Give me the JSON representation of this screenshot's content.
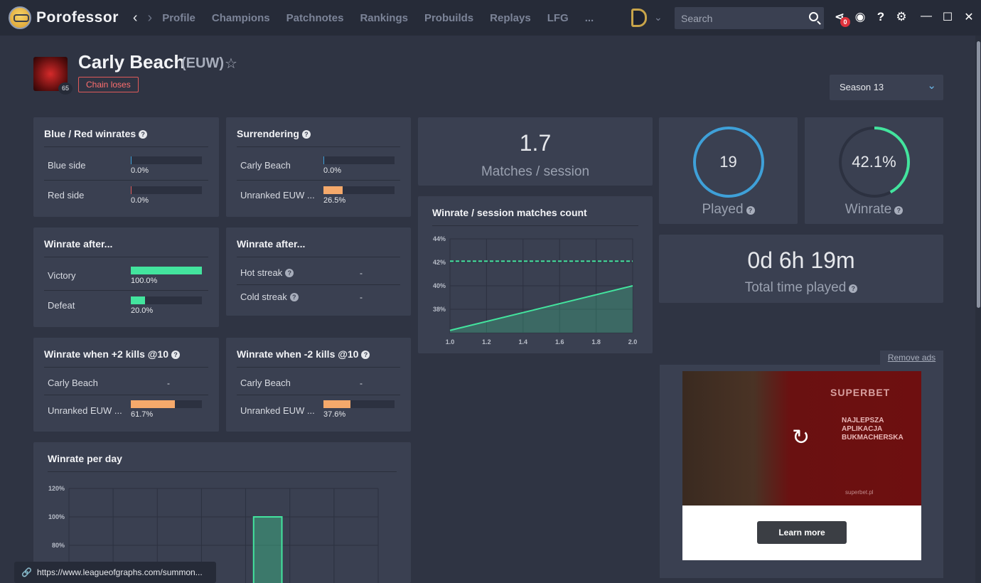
{
  "app": {
    "name": "Porofessor"
  },
  "nav": {
    "back": "‹",
    "forward": "›",
    "links": [
      "Profile",
      "Champions",
      "Patchnotes",
      "Rankings",
      "Probuilds",
      "Replays",
      "LFG",
      "..."
    ]
  },
  "search": {
    "placeholder": "Search"
  },
  "toolbar": {
    "share_badge": "0",
    "help": "?",
    "gear": "⚙"
  },
  "window": {
    "minimize": "—",
    "maximize": "☐",
    "close": "✕"
  },
  "profile": {
    "name": "Carly Beach",
    "region": "(EUW)",
    "level": "65",
    "tag": "Chain loses",
    "star": "☆"
  },
  "season": {
    "selected": "Season 13"
  },
  "colors": {
    "accent_green": "#43e49e",
    "accent_orange": "#f5a96b",
    "accent_blue": "#3fa0d8",
    "accent_red": "#e05a5a"
  },
  "blue_red": {
    "title": "Blue / Red winrates",
    "rows": [
      {
        "label": "Blue side",
        "value": "0.0%",
        "pct": 0.5,
        "color": "#3fa0d8"
      },
      {
        "label": "Red side",
        "value": "0.0%",
        "pct": 0.5,
        "color": "#e05a5a"
      }
    ]
  },
  "surrender": {
    "title": "Surrendering",
    "rows": [
      {
        "label": "Carly Beach",
        "value": "0.0%",
        "pct": 0.5,
        "color": "#3fa0d8"
      },
      {
        "label": "Unranked EUW ...",
        "value": "26.5%",
        "pct": 26.5,
        "color": "#f5a96b"
      }
    ]
  },
  "winrate_after1": {
    "title": "Winrate after...",
    "rows": [
      {
        "label": "Victory",
        "value": "100.0%",
        "pct": 100,
        "color": "#43e49e"
      },
      {
        "label": "Defeat",
        "value": "20.0%",
        "pct": 20,
        "color": "#43e49e"
      }
    ]
  },
  "winrate_after2": {
    "title": "Winrate after...",
    "rows": [
      {
        "label": "Hot streak",
        "value": "-"
      },
      {
        "label": "Cold streak",
        "value": "-"
      }
    ]
  },
  "kills_plus": {
    "title": "Winrate when +2 kills @10",
    "rows": [
      {
        "label": "Carly Beach",
        "value": "-"
      },
      {
        "label": "Unranked EUW ...",
        "value": "61.7%",
        "pct": 61.7,
        "color": "#f5a96b"
      }
    ]
  },
  "kills_minus": {
    "title": "Winrate when -2 kills @10",
    "rows": [
      {
        "label": "Carly Beach",
        "value": "-"
      },
      {
        "label": "Unranked EUW ...",
        "value": "37.6%",
        "pct": 37.6,
        "color": "#f5a96b"
      }
    ]
  },
  "matches_session": {
    "value": "1.7",
    "label": "Matches / session"
  },
  "played": {
    "value": "19",
    "label": "Played",
    "ring_fraction": 1.0
  },
  "winrate": {
    "value": "42.1%",
    "label": "Winrate",
    "ring_fraction": 0.421
  },
  "total_time": {
    "value": "0d 6h 19m",
    "label": "Total time played"
  },
  "session_chart_title": "Winrate / session matches count",
  "day_chart_title": "Winrate per day",
  "chart_data": [
    {
      "type": "line",
      "title": "Winrate / session matches count",
      "x": [
        1.0,
        2.0
      ],
      "series": [
        {
          "values": [
            36.2,
            40.0
          ]
        }
      ],
      "reference_line": 42.1,
      "xticks": [
        "1.0",
        "1.2",
        "1.4",
        "1.6",
        "1.8",
        "2.0"
      ],
      "yticks": [
        "44%",
        "42%",
        "40%",
        "38%"
      ],
      "xlim": [
        1.0,
        2.0
      ],
      "ylim": [
        36,
        44
      ],
      "grid": true
    },
    {
      "type": "bar",
      "title": "Winrate per day",
      "categories": [
        "",
        "",
        "",
        "",
        "",
        "",
        ""
      ],
      "values": [
        null,
        null,
        null,
        null,
        100,
        null,
        null
      ],
      "yticks": [
        "120%",
        "100%",
        "80%"
      ],
      "ylim": [
        40,
        120
      ],
      "grid": true
    }
  ],
  "statusbar": {
    "url": "https://www.leagueofgraphs.com/summon..."
  },
  "ad": {
    "remove_ads": "Remove ads",
    "brand": "SUPERBET",
    "tagline": "NAJLEPSZA APLIKACJA BUKMACHERSKA",
    "url": "superbet.pl",
    "cta": "Learn more"
  }
}
